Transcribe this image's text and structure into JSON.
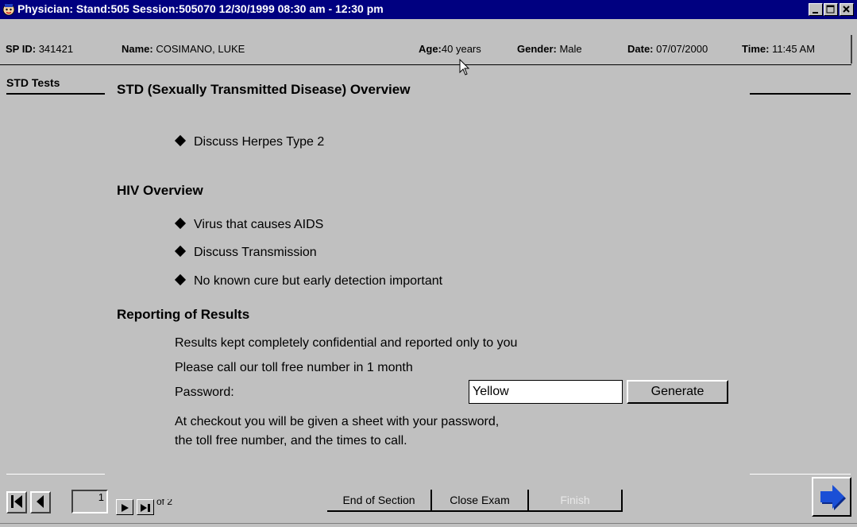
{
  "window": {
    "title": "Physician: Stand:505 Session:505070 12/30/1999 08:30 am - 12:30 pm"
  },
  "infobar": {
    "sp_id_label": "SP ID:",
    "sp_id_value": "341421",
    "name_label": "Name:",
    "name_value": "COSIMANO, LUKE",
    "age_label": "Age:",
    "age_value": "40 years",
    "gender_label": "Gender:",
    "gender_value": "Male",
    "date_label": "Date:",
    "date_value": "07/07/2000",
    "time_label": "Time:",
    "time_value": "11:45 AM"
  },
  "tab": {
    "label": "STD Tests"
  },
  "content": {
    "std_heading": "STD (Sexually Transmitted Disease) Overview",
    "std_bullets": [
      "Discuss Herpes Type 2"
    ],
    "hiv_heading": "HIV Overview",
    "hiv_bullets": [
      "Virus that causes AIDS",
      "Discuss Transmission",
      "No known cure but early detection important"
    ],
    "reporting_heading": "Reporting of Results",
    "reporting_line1": "Results kept completely confidential and reported only to you",
    "reporting_line2": "Please call our toll free number in 1 month",
    "password_label": "Password:",
    "password_value": "Yellow",
    "generate_label": "Generate",
    "checkout_line1": "At checkout you will be given a sheet with your password,",
    "checkout_line2": "the toll free number, and the times to call."
  },
  "footer": {
    "page_number": "1",
    "page_of": "of 2",
    "end_section_label": "End of Section",
    "close_exam_label": "Close Exam",
    "finish_label": "Finish"
  },
  "colors": {
    "title_bar": "#000080",
    "background": "#c0c0c0",
    "next_arrow": "#1a4fd6"
  }
}
